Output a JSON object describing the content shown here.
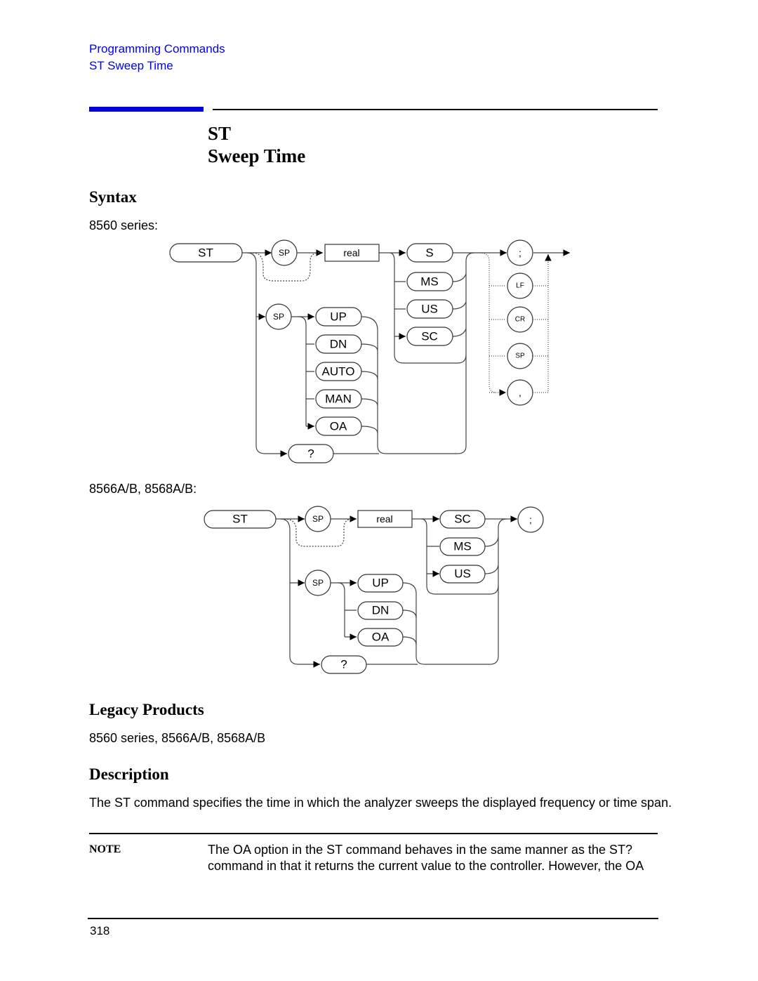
{
  "breadcrumb": [
    "Programming Commands",
    "ST Sweep Time"
  ],
  "title": {
    "command": "ST",
    "name": "Sweep Time"
  },
  "syntax": {
    "heading": "Syntax",
    "d1": {
      "label": "8560 series:",
      "st": "ST",
      "sp": "SP",
      "real": "real",
      "units": [
        "S",
        "MS",
        "US",
        "SC"
      ],
      "options": [
        "UP",
        "DN",
        "AUTO",
        "MAN",
        "OA"
      ],
      "query": "?",
      "terminators": [
        ";",
        "LF",
        "CR",
        "SP",
        ","
      ]
    },
    "d2": {
      "label": "8566A/B, 8568A/B:",
      "st": "ST",
      "sp": "SP",
      "real": "real",
      "units": [
        "SC",
        "MS",
        "US"
      ],
      "options": [
        "UP",
        "DN",
        "OA"
      ],
      "query": "?",
      "terminator": ";"
    }
  },
  "legacy": {
    "heading": "Legacy Products",
    "text": "8560 series, 8566A/B, 8568A/B"
  },
  "description": {
    "heading": "Description",
    "text": "The ST command specifies the time in which the analyzer sweeps the displayed frequency or time span."
  },
  "note": {
    "label": "NOTE",
    "line1": "The OA option in the ST command behaves in the same manner as the ST?",
    "line2": "command in that it returns the current value to the controller. However, the OA"
  },
  "footer": {
    "page": "318"
  },
  "colors": {
    "link": "#0000ee",
    "accent_bar": "#0000dd"
  }
}
